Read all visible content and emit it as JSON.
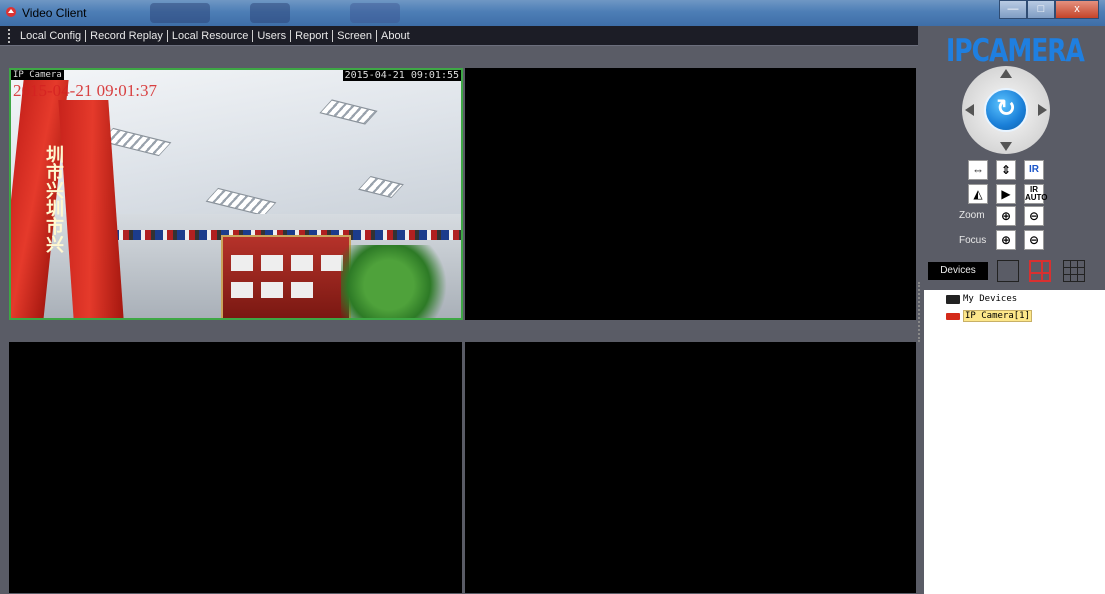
{
  "window": {
    "title": "Video Client",
    "controls": [
      "—",
      "□",
      "x"
    ]
  },
  "menu": [
    "Local Config",
    "Record Replay",
    "Local Resource",
    "Users",
    "Report",
    "Screen",
    "About"
  ],
  "video": {
    "camera_name": "IP Camera",
    "timestamp": "2015-04-21 09:01:55",
    "overlay_time": "2015-04-21 09:01:37",
    "flag_text": "圳市兴圳市兴"
  },
  "brand": {
    "logo": "IPCAMERA",
    "accent": "#1f7fe0"
  },
  "ptz": {
    "center_glyph": "↻",
    "buttons": {
      "flip_h": "⇔",
      "flip_v": "⇕",
      "ir": "IR",
      "mirror": "◭",
      "play": "▶",
      "ir_auto_top": "IR",
      "ir_auto_bottom": "AUTO",
      "zoom_in": "⊕",
      "zoom_out": "⊖",
      "focus_in": "⊕",
      "focus_out": "⊖"
    },
    "zoom_label": "Zoom",
    "focus_label": "Focus"
  },
  "devices": {
    "tab_label": "Devices",
    "tree": {
      "root": "My Devices",
      "items": [
        "IP Camera[1]"
      ]
    }
  }
}
